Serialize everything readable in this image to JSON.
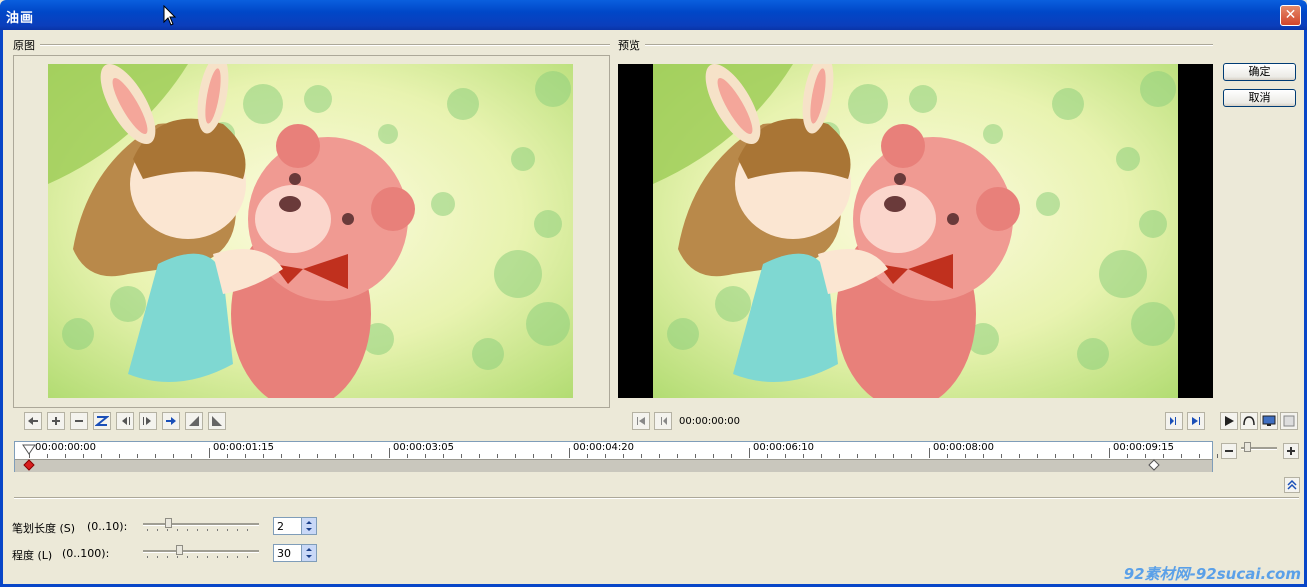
{
  "window": {
    "title": "油画"
  },
  "labels": {
    "original": "原图",
    "preview": "预览"
  },
  "buttons": {
    "ok": "确定",
    "cancel": "取消"
  },
  "preview_time": "00:00:00:00",
  "timeline": {
    "ticks": [
      "00:00:00:00",
      "00:00:01:15",
      "00:00:03:05",
      "00:00:04:20",
      "00:00:06:10",
      "00:00:08:00",
      "00:00:09:15"
    ]
  },
  "params": {
    "stroke": {
      "label": "笔划长度 (S)",
      "range": "(0..10):",
      "value": "2",
      "level": 0.2
    },
    "degree": {
      "label": "程度 (L)",
      "range": "(0..100):",
      "value": "30",
      "level": 0.3
    }
  },
  "watermark": "92素材网-92sucai.com",
  "colors": {
    "titlebar": "#0a5fde",
    "background": "#ece9d8",
    "keyframe_start": "#d81e1e"
  }
}
